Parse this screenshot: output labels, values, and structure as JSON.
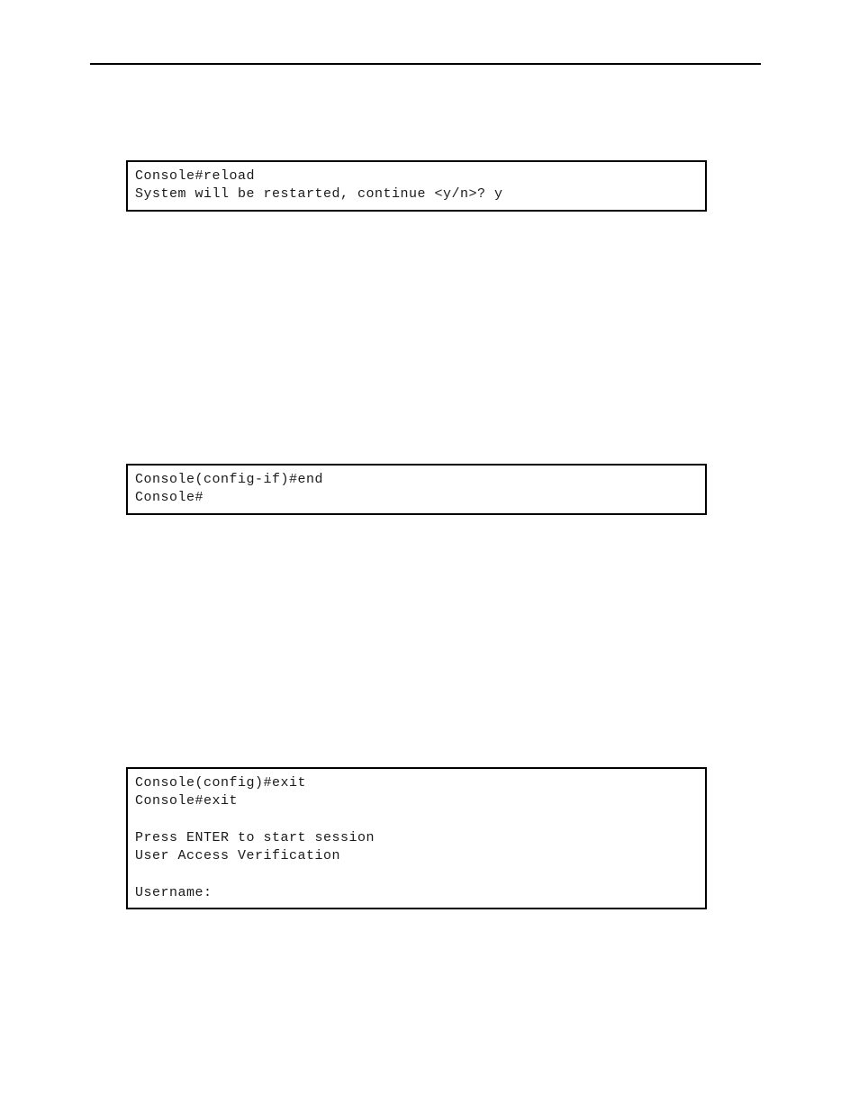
{
  "codeboxes": {
    "box1": {
      "text": "Console#reload\nSystem will be restarted, continue <y/n>? y"
    },
    "box2": {
      "text": "Console(config-if)#end\nConsole#"
    },
    "box3": {
      "text": "Console(config)#exit\nConsole#exit\n\nPress ENTER to start session\nUser Access Verification\n\nUsername:"
    }
  }
}
